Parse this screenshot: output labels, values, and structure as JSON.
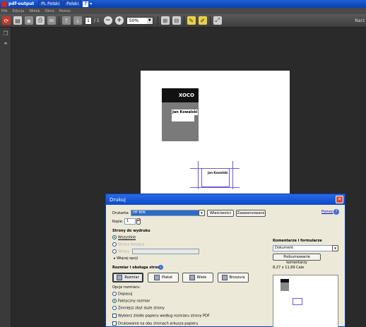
{
  "titlebar": {
    "doc_title": "pdf-output",
    "lang1": "PL Polski",
    "lang2": "Polski",
    "help": "?"
  },
  "menubar": {
    "items": [
      "Plik",
      "Edycja",
      "Widok",
      "Okno",
      "Pomoc"
    ]
  },
  "toolbar": {
    "page_number": "1",
    "page_total": "/ 1",
    "zoom_value": "50%",
    "right_text": "Narz"
  },
  "document": {
    "logo_text": "XOCO",
    "card_name": "Jan Kowalski",
    "card_name_small": "Jan Kowalski"
  },
  "print_dialog": {
    "title": "Drukuj",
    "printer_label": "Drukarka",
    "printer_value": "HP 80K",
    "properties_button": "Właściwości",
    "advanced_button": "Zaawansowane",
    "help_link": "Pomoc",
    "copies_label": "Kopie:",
    "copies_value": "1",
    "pages_section": "Strony do wydruku",
    "radio_all": "Wszystkie",
    "radio_current": "Strona bieżąca",
    "radio_pages": "Strony",
    "more_options": "Więcej opcji",
    "size_section": "Rozmiar i obsługa stron",
    "btn_size": "Rozmiar",
    "btn_poster": "Plakat",
    "btn_multiple": "Wiele",
    "btn_booklet": "Broszura",
    "size_options_label": "Opcje rozmiaru:",
    "opt_fit": "Dopasuj",
    "opt_actual": "Faktyczny rozmiar",
    "opt_shrink": "Zmniejsz zbyt duże strony",
    "check_paper_source": "Wybierz źródło papieru według rozmiaru strony PDF",
    "check_duplex": "Drukowanie na obu stronach arkusza papieru",
    "comments_section": "Komentarze i formularze",
    "comments_value": "Dokument",
    "summarize_button": "Podsumowanie komentarzy",
    "paper_size": "8,27 x 11,69 Cale"
  }
}
